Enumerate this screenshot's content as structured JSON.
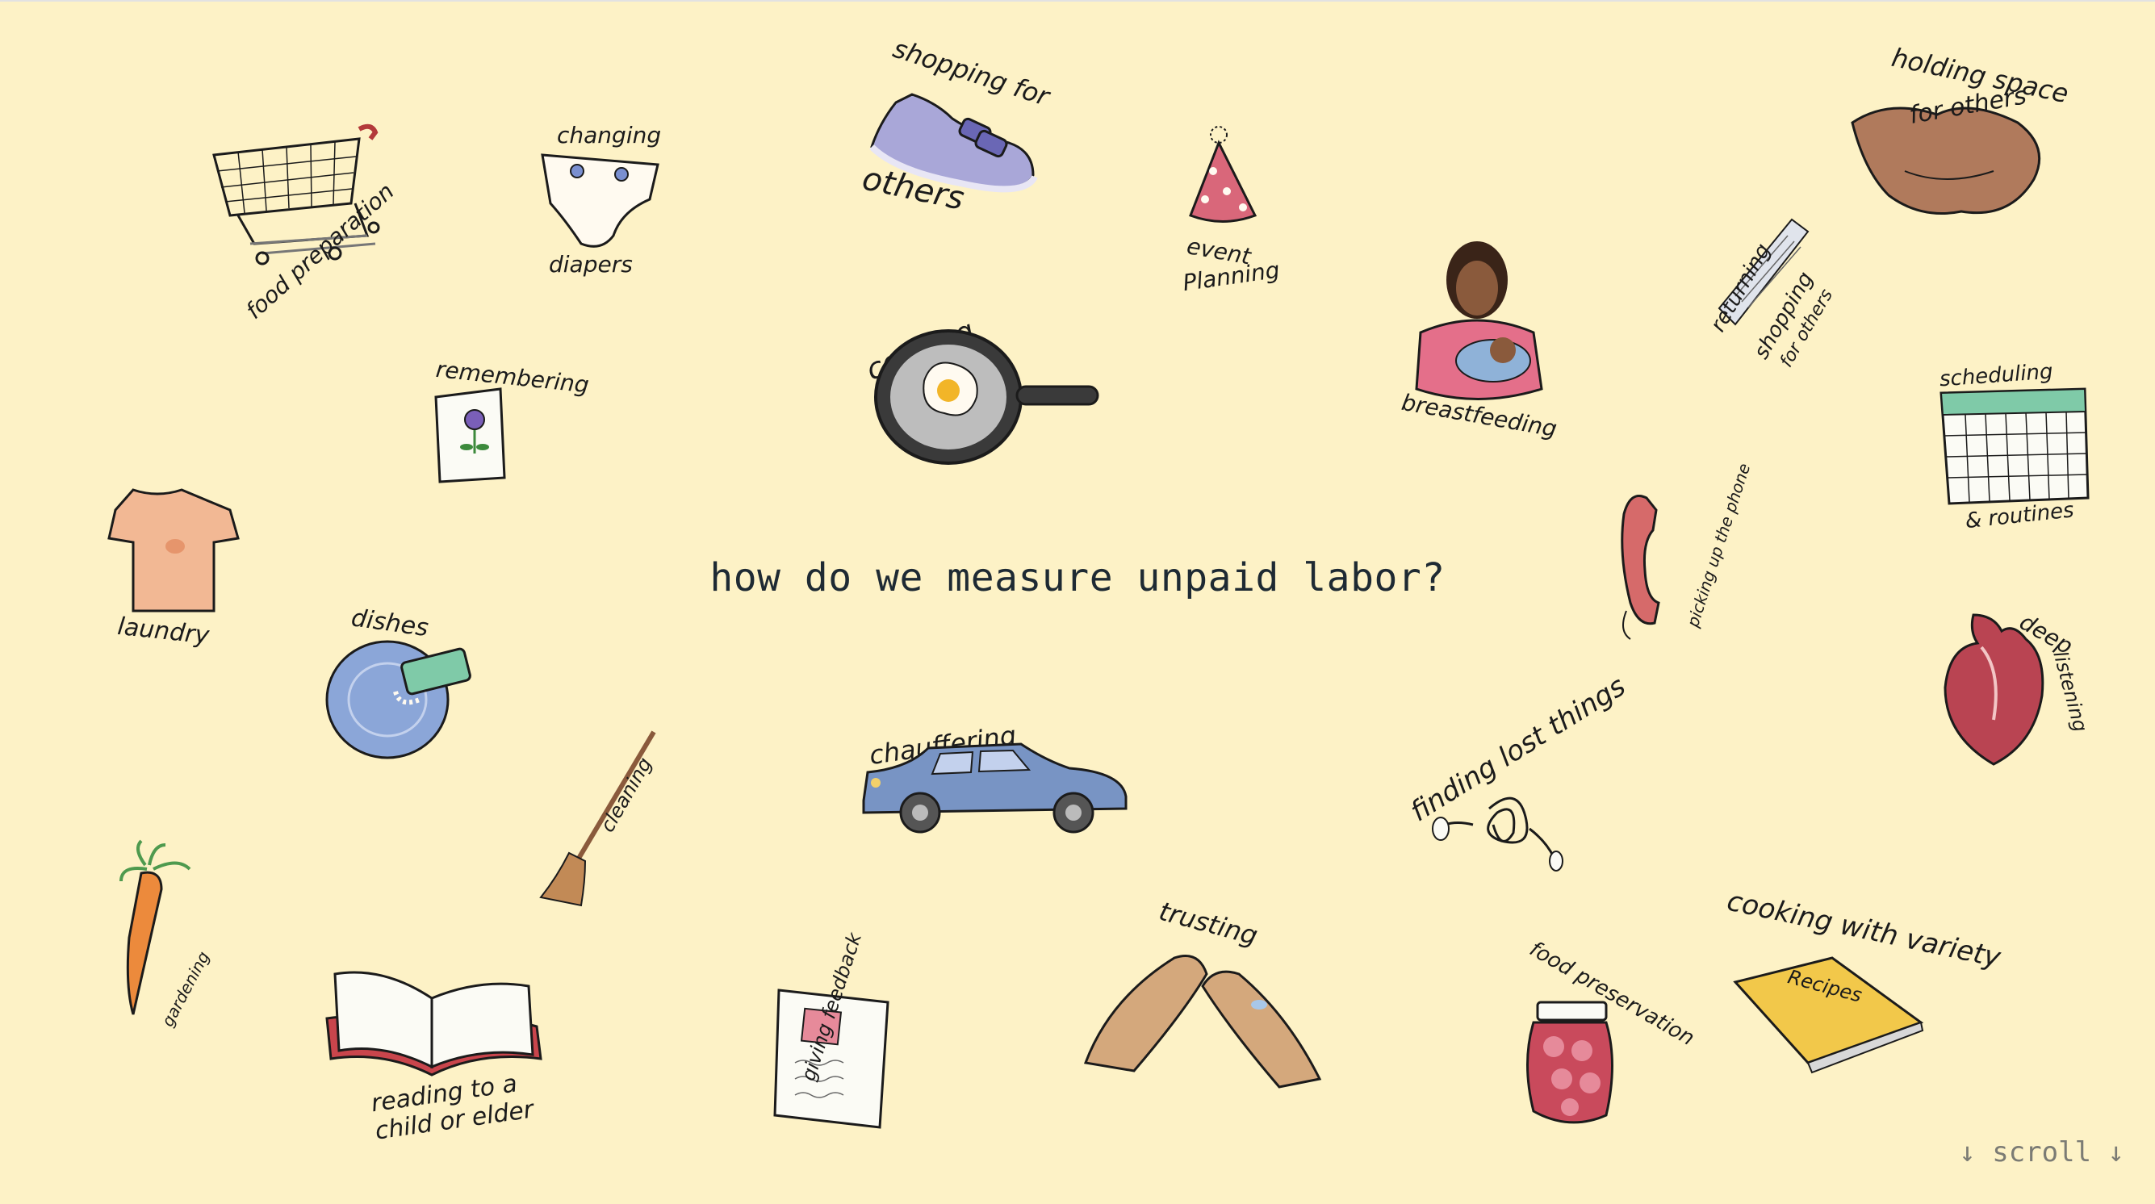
{
  "question": "how do we measure unpaid labor?",
  "scroll_label": "↓ scroll ↓",
  "labels": {
    "food_preparation": "food preparation",
    "changing": "changing",
    "diapers": "diapers",
    "shopping_for": "shopping for",
    "others": "others",
    "event": "event",
    "planning": "Planning",
    "holding_space": "holding space",
    "for_others": "for others",
    "remembering": "remembering",
    "cooking": "cooking",
    "breastfeeding": "breastfeeding",
    "returning": "returning",
    "returning_shopping": "shopping",
    "returning_for_others": "for others",
    "scheduling": "scheduling",
    "routines": "& routines",
    "laundry": "laundry",
    "picking_up_phone": "picking up the phone",
    "deep": "deep",
    "listening": "listening",
    "dishes": "dishes",
    "cleaning": "cleaning",
    "chauffering": "chauffering",
    "finding_lost_things": "finding lost things",
    "gardening": "gardening",
    "reading_line1": "reading to a",
    "reading_line2": "child or elder",
    "giving_feedback": "giving feedback",
    "trusting": "trusting",
    "food_preservation": "food preservation",
    "cooking_with_variety": "cooking with variety",
    "recipes": "Recipes"
  },
  "colors": {
    "background": "#fdf2c6",
    "ink": "#1b1b1b",
    "question_text": "#1e2a33",
    "scroll_text": "#7b7b74"
  }
}
